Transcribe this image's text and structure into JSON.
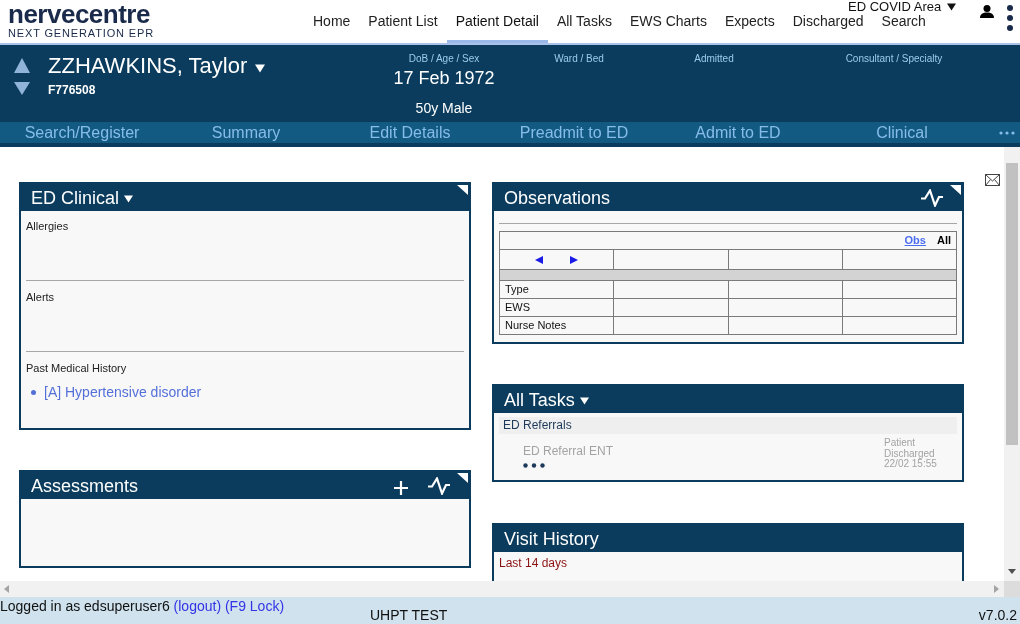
{
  "header": {
    "logo": "nervecentre",
    "tagline": "NEXT GENERATION EPR",
    "nav": [
      {
        "label": "Home",
        "selected": false
      },
      {
        "label": "Patient List",
        "selected": false
      },
      {
        "label": "Patient Detail",
        "selected": true
      },
      {
        "label": "All Tasks",
        "selected": false
      },
      {
        "label": "EWS Charts",
        "selected": false
      },
      {
        "label": "Expects",
        "selected": false
      },
      {
        "label": "Discharged",
        "selected": false
      },
      {
        "label": "Search",
        "selected": false
      }
    ],
    "area": "ED COVID Area"
  },
  "patient": {
    "name": "ZZHAWKINS, Taylor",
    "number": "F776508",
    "fields": [
      {
        "label": "DoB / Age / Sex",
        "value": "17 Feb 1972",
        "detail": "50y Male"
      },
      {
        "label": "Ward / Bed"
      },
      {
        "label": "Admitted"
      },
      {
        "label": "Consultant / Specialty"
      }
    ]
  },
  "menu": [
    "Search/Register",
    "Summary",
    "Edit Details",
    "Preadmit to ED",
    "Admit to ED",
    "Clinical"
  ],
  "columns": [
    [
      {
        "kind": "clinical",
        "title": "ED Clinical",
        "dropdown": true,
        "sections": [
          {
            "label": "Allergies"
          },
          {
            "label": "Alerts"
          },
          {
            "label": "Past Medical History",
            "items": [
              "[A] Hypertensive disorder"
            ]
          }
        ]
      },
      {
        "kind": "assessments",
        "title": "Assessments",
        "dropdown": false
      }
    ],
    [
      {
        "kind": "observations",
        "title": "Observations",
        "dropdown": false,
        "filters": [
          {
            "label": "Obs",
            "selected": false
          },
          {
            "label": "All",
            "selected": true
          }
        ],
        "rows": [
          "Type",
          "EWS",
          "Nurse Notes"
        ]
      },
      {
        "kind": "tasks",
        "title": "All Tasks",
        "dropdown": true,
        "groups": [
          {
            "name": "ED Referrals",
            "tasks": [
              {
                "title": "ED Referral ENT",
                "status": "Patient Discharged 22/02 15:55",
                "disabled": true
              }
            ]
          }
        ]
      },
      {
        "kind": "visits",
        "title": "Visit History",
        "dropdown": false,
        "period": "Last 14 days"
      }
    ]
  ],
  "footer": {
    "login": "Logged in as edsuperuser6",
    "logout": "(logout)",
    "lock": "(F9 Lock)",
    "environment": "UHPT TEST",
    "version": "v7.0.2"
  }
}
